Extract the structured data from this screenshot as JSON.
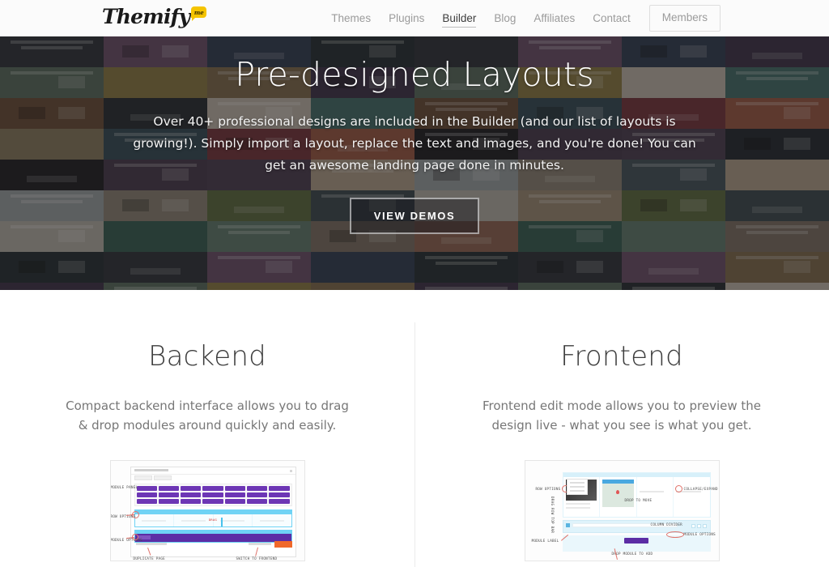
{
  "header": {
    "logo": {
      "text": "Themify",
      "bubble_text": "me",
      "bubble_color": "#f5c400"
    },
    "nav": [
      {
        "label": "Themes",
        "active": false
      },
      {
        "label": "Plugins",
        "active": false
      },
      {
        "label": "Builder",
        "active": true
      },
      {
        "label": "Blog",
        "active": false
      },
      {
        "label": "Affiliates",
        "active": false
      },
      {
        "label": "Contact",
        "active": false
      }
    ],
    "members_button": "Members"
  },
  "hero": {
    "title": "Pre-designed Layouts",
    "description": "Over 40+ professional designs are included in the Builder (and our list of layouts is growing!). Simply import a layout, replace the text and images, and you're done! You can get an awesome landing page done in minutes.",
    "cta_label": "VIEW DEMOS"
  },
  "features": [
    {
      "title": "Backend",
      "description": "Compact backend interface allows you to drag & drop modules around quickly and easily.",
      "screenshot_name": "builder-backend-screenshot",
      "annotations": [
        "MODULE PANEL",
        "ROW OPTIONS",
        "MODULE OPTIONS",
        "DUPLICATE PAGE",
        "SWITCH TO FRONTEND",
        "DRAG",
        "DRAG"
      ],
      "panel_title": "Themify Custom Panel",
      "save_label": "SAVE",
      "save_color": "#f0682a",
      "module_color": "#6d36b5",
      "row_color": "#6fd3f5"
    },
    {
      "title": "Frontend",
      "description": "Frontend edit mode allows you to preview the design live - what you see is what you get.",
      "screenshot_name": "builder-frontend-screenshot",
      "annotations": [
        "ROW OPTIONS",
        "COLLAPSE/EXPAND",
        "DROP TO MOVE",
        "COLUMN DIVIDER",
        "MODULE OPTIONS",
        "MODULE LABEL",
        "DROP MODULE TO ADD",
        "DRAG ROW TOP BAR"
      ]
    }
  ],
  "colors": {
    "header_bg": "#fbfbfb",
    "nav_inactive": "#9b9b9b",
    "nav_active": "#3d3d3d",
    "hero_overlay": "rgba(30,27,25,0.50)",
    "body_text": "#777777",
    "heading_text": "#3c3c3c",
    "divider": "#ececec"
  }
}
